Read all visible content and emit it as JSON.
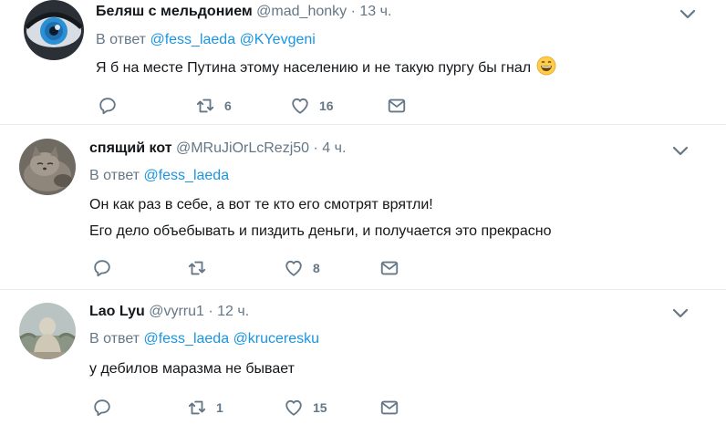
{
  "colors": {
    "accent": "#1b95e0",
    "secondary": "#657786",
    "divider": "#e6ecf0",
    "text": "#14171a"
  },
  "tweets": [
    {
      "name": "Беляш с мельдонием",
      "handle": "@mad_honky",
      "separator": "·",
      "time": "13 ч.",
      "reply_prefix": "В ответ",
      "mentions": [
        "@fess_laeda",
        "@KYevgeni"
      ],
      "lines": [
        "Я б на месте Путина этому населению и не такую пургу бы гнал"
      ],
      "emoji": "grinning-face-icon",
      "replies": "",
      "retweets": "6",
      "likes": "16"
    },
    {
      "name": "спящий кот",
      "handle": "@MRuJiOrLcRezj50",
      "separator": "·",
      "time": "4 ч.",
      "reply_prefix": "В ответ",
      "mentions": [
        "@fess_laeda"
      ],
      "lines": [
        "Он как раз в себе, а вот те кто его смотрят врятли!",
        "Его дело объебывать и пиздить деньги, и получается это прекрасно"
      ],
      "replies": "",
      "retweets": "",
      "likes": "8"
    },
    {
      "name": "Lao Lyu",
      "handle": "@vyrru1",
      "separator": "·",
      "time": "12 ч.",
      "reply_prefix": "В ответ",
      "mentions": [
        "@fess_laeda",
        "@kruceresku"
      ],
      "lines": [
        "у дебилов маразма не бывает"
      ],
      "replies": "",
      "retweets": "1",
      "likes": "15"
    }
  ]
}
